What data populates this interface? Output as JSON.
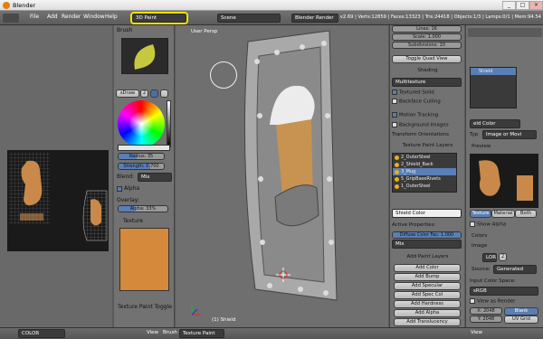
{
  "window": {
    "title": "Blender",
    "min": "_",
    "max": "□",
    "close": "×"
  },
  "menus": [
    "File",
    "Add",
    "Render",
    "Window",
    "Help"
  ],
  "screen_layout": "3D Paint",
  "scene": "Scene",
  "render_engine": "Blender Render",
  "stats": "v2.69 | Verts:12859 | Faces:13323 | Tris:24418 | Objects:1/3 | Lamps:0/1 | Mem:94.54",
  "tool_panel": {
    "brush_header": "Brush",
    "brush_name": "sDraw",
    "brush_users": "2",
    "radius": "Radius: 35",
    "strength": "Strength: 0.700",
    "blend_label": "Blend:",
    "blend_value": "Mix",
    "alpha_label": "Alpha",
    "overlay_label": "Overlay:",
    "overlay_alpha": "Alpha: 33%",
    "texture_header": "Texture",
    "texture_toggle": "Texture Paint Toggle"
  },
  "viewport": {
    "label": "User Persp",
    "object": "(1) Shield"
  },
  "props": {
    "lines": "Lines: 16",
    "scale": "Scale: 1.000",
    "subdiv": "Subdivisions: 10",
    "toggle_quad": "Toggle Quad View",
    "shading_header": "Shading",
    "shading_mode": "Multitexture",
    "textured_solid": "Textured Solid",
    "backface": "Backface Culling",
    "motion_tracking": "Motion Tracking",
    "background_images": "Background Images",
    "transform_orient": "Transform Orientations",
    "paint_layers_header": "Texture Paint Layers",
    "layers": [
      "2_OuterSteel",
      "2_Shield_Back",
      "3_Mug",
      "5_GripBaseRivets",
      "1_OuterSteel"
    ],
    "selected_layer": 2,
    "shield_color": "Shield Color",
    "active_props": "Active Properties:",
    "diffuse_fac": "Diffuse Color Fac: 1.000",
    "blend_mix": "Mix",
    "add_layers_header": "Add Paint Layers",
    "add_buttons": [
      "Add Color",
      "Add Bump",
      "Add Specular",
      "Add Spec Col",
      "Add Hardness",
      "Add Alpha",
      "Add Translucency"
    ]
  },
  "right_panel": {
    "tex_name": "Shield",
    "tex_slot": "eld Color",
    "type_label": "Typ",
    "type_value": "Image or Movi",
    "preview_header": "Preview",
    "tabs": [
      "Texture",
      "Material",
      "Both"
    ],
    "show_alpha": "Show Alpha",
    "colors_header": "Colors",
    "image_header": "Image",
    "image_name": "LOR",
    "image_users": "2",
    "source_label": "Source:",
    "source_value": "Generated",
    "input_color_space": "Input Color Space:",
    "color_space": "sRGB",
    "view_as_render": "View as Render",
    "x_size": "X: 2048",
    "y_size": "Y: 2048",
    "blank": "Blank",
    "uv_grid": "UV Grid",
    "float_buffer": "Float Bu",
    "color_grid": "Color Grid"
  },
  "bottom": {
    "uv_menu": "COLOR",
    "view": "View",
    "brush": "Brush",
    "mode": "Texture Paint",
    "view2": "View"
  },
  "colors": {
    "accent": "#5a7eb6",
    "highlight": "#f2e100",
    "texture_orange": "#d48a3a"
  }
}
